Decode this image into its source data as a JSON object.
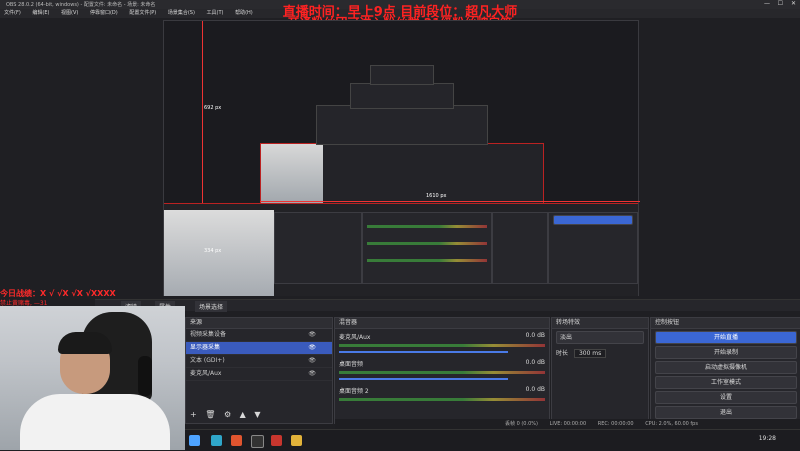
{
  "window": {
    "title": "OBS 28.0.2 (64-bit, windows) - 配置文件: 未命名 - 场景: 未命名"
  },
  "menu": [
    "文件(F)",
    "编辑(E)",
    "视图(V)",
    "停靠窗口(D)",
    "配置文件(P)",
    "场景集合(S)",
    "工具(T)",
    "帮助(H)"
  ],
  "overlay": {
    "line1": "直播时间：早上9点 目前段位：超凡大师",
    "line2": "开通粉丝团可进入粉丝群 21级粉丝牌房管",
    "score": "今日战绩：X √ √X √X √XXXX",
    "warn": "禁止黄赌毒, —31"
  },
  "preview": {
    "dim_h": "692 px",
    "dim_w": "1610 px",
    "dim_small": "334 px"
  },
  "tabs": [
    "滤镜",
    "属性",
    "场景选择"
  ],
  "docks": {
    "scenes_title": "来源",
    "mixer_title": "混音器",
    "transitions_title": "转场特效",
    "controls_title": "控制按钮"
  },
  "sources": [
    {
      "label": "视频采集设备",
      "selected": false
    },
    {
      "label": "显示器采集",
      "selected": true
    },
    {
      "label": "文本 (GDI+)",
      "selected": false
    },
    {
      "label": "麦克风/Aux",
      "selected": false
    }
  ],
  "mixer": [
    {
      "label": "麦克风/Aux",
      "db": "0.0 dB"
    },
    {
      "label": "桌面音频",
      "db": "0.0 dB"
    },
    {
      "label": "桌面音频 2",
      "db": "0.0 dB"
    }
  ],
  "transitions": {
    "type": "淡出",
    "duration_label": "时长",
    "duration": "300 ms"
  },
  "controls": [
    {
      "label": "开始直播",
      "primary": true
    },
    {
      "label": "开始录制",
      "primary": false
    },
    {
      "label": "启动虚拟摄像机",
      "primary": false
    },
    {
      "label": "工作室模式",
      "primary": false
    },
    {
      "label": "设置",
      "primary": false
    },
    {
      "label": "退出",
      "primary": false
    }
  ],
  "status": {
    "dropped": "丢帧 0 (0.0%)",
    "live": "LIVE: 00:00:00",
    "rec": "REC: 00:00:00",
    "cpu": "CPU: 2.0%, 60.00 fps",
    "clock": "19:28"
  }
}
